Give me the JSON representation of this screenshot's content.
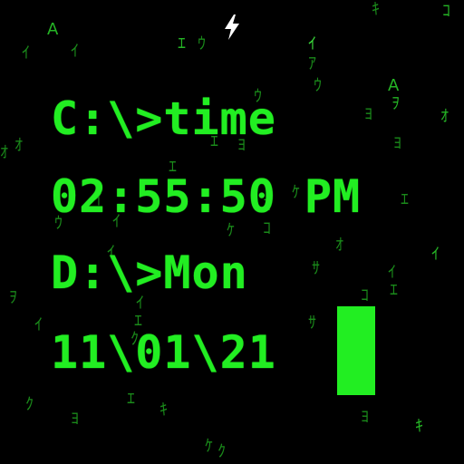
{
  "terminal": {
    "line1": "C:\\>time",
    "line2": "02:55:50 PM",
    "line3": "D:\\>Mon",
    "line4": "11\\01\\21"
  },
  "icons": {
    "status": "lightning-bolt-icon",
    "cursor": "block-cursor"
  },
  "colors": {
    "background": "#000000",
    "text": "#22ee22",
    "rain_dim": "#1a8a1a",
    "rain_bright": "#39d639",
    "bolt": "#ffffff"
  },
  "rain": {
    "glyphs": [
      "ｴ",
      "ｳ",
      "ｲ",
      "A",
      "ｲ",
      "ｱ",
      "ｳ",
      "ﾖ",
      "ｵ",
      "ｵ",
      "ﾖ",
      "ｳ",
      "A",
      "ｦ",
      "ｵ",
      "ｴ",
      "ｲ",
      "ｺ",
      "ｲ",
      "ｹ",
      "ｹ",
      "ｺ",
      "ｲ",
      "ｵ",
      "ｻ",
      "ｲ",
      "ｴ",
      "ｦ",
      "ｲ",
      "ｴ",
      "ｻ",
      "ｸ",
      "ｺ",
      "ｲ",
      "ｷ",
      "ｴ",
      "ｸ",
      "ﾖ",
      "ｷ",
      "ｹ",
      "ｸ",
      "ﾖ",
      "ｷ",
      "ｺ",
      "ｴ",
      "ｲ",
      "ﾖ",
      "ｲ",
      "ｳ",
      "ｴ"
    ]
  }
}
